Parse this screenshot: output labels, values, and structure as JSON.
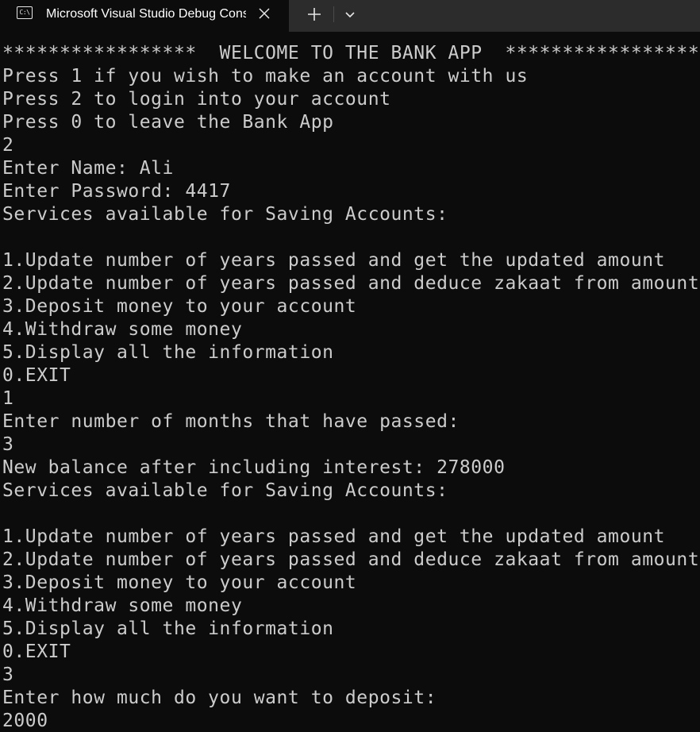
{
  "tab": {
    "title": "Microsoft Visual Studio Debug Console",
    "icon": "console-icon",
    "icon_text": "C:\\"
  },
  "controls": {
    "close_icon": "close-icon",
    "new_tab_icon": "plus-icon",
    "dropdown_icon": "chevron-down-icon"
  },
  "colors": {
    "background": "#0c0c0c",
    "text": "#cccccc",
    "tabbar": "#2c2c2c"
  },
  "console": {
    "lines": [
      "*****************  WELCOME TO THE BANK APP  *****************",
      "Press 1 if you wish to make an account with us",
      "Press 2 to login into your account",
      "Press 0 to leave the Bank App",
      "2",
      "Enter Name: Ali",
      "Enter Password: 4417",
      "Services available for Saving Accounts:",
      "",
      "1.Update number of years passed and get the updated amount",
      "2.Update number of years passed and deduce zakaat from amount",
      "3.Deposit money to your account",
      "4.Withdraw some money",
      "5.Display all the information",
      "0.EXIT",
      "1",
      "Enter number of months that have passed:",
      "3",
      "New balance after including interest: 278000",
      "Services available for Saving Accounts:",
      "",
      "1.Update number of years passed and get the updated amount",
      "2.Update number of years passed and deduce zakaat from amount",
      "3.Deposit money to your account",
      "4.Withdraw some money",
      "5.Display all the information",
      "0.EXIT",
      "3",
      "Enter how much do you want to deposit:",
      "2000"
    ]
  }
}
